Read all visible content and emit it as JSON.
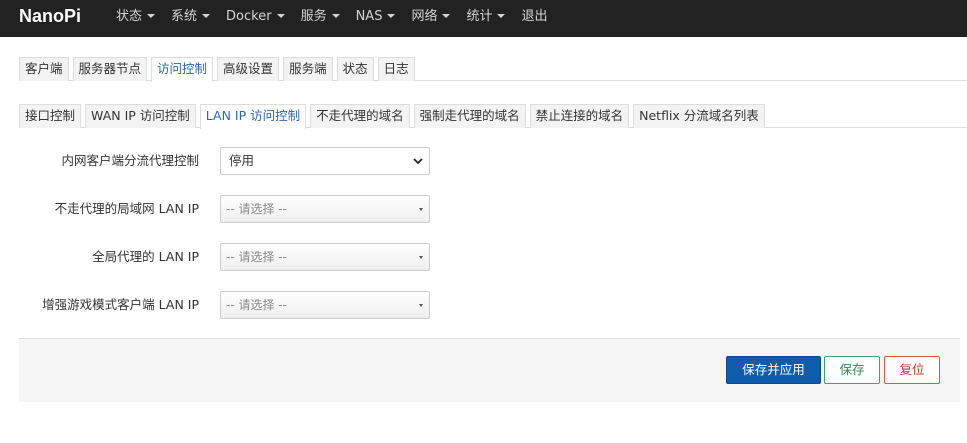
{
  "app": {
    "brand": "NanoPi"
  },
  "nav": {
    "items": [
      {
        "label": "状态",
        "caret": true
      },
      {
        "label": "系统",
        "caret": true
      },
      {
        "label": "Docker",
        "caret": true
      },
      {
        "label": "服务",
        "caret": true
      },
      {
        "label": "NAS",
        "caret": true
      },
      {
        "label": "网络",
        "caret": true
      },
      {
        "label": "统计",
        "caret": true
      },
      {
        "label": "退出",
        "caret": false
      }
    ]
  },
  "main_tabs": [
    {
      "label": "客户端"
    },
    {
      "label": "服务器节点"
    },
    {
      "label": "访问控制",
      "active": true
    },
    {
      "label": "高级设置"
    },
    {
      "label": "服务端"
    },
    {
      "label": "状态"
    },
    {
      "label": "日志"
    }
  ],
  "sub_tabs": [
    {
      "label": "接口控制"
    },
    {
      "label": "WAN IP 访问控制"
    },
    {
      "label": "LAN IP 访问控制",
      "active": true
    },
    {
      "label": "不走代理的域名"
    },
    {
      "label": "强制走代理的域名"
    },
    {
      "label": "禁止连接的域名"
    },
    {
      "label": "Netflix 分流域名列表"
    }
  ],
  "form": {
    "proxy_control": {
      "label": "内网客户端分流代理控制",
      "value": "停用"
    },
    "bypass_lan_ip": {
      "label": "不走代理的局域网 LAN IP",
      "placeholder": "-- 请选择 --"
    },
    "global_lan_ip": {
      "label": "全局代理的 LAN IP",
      "placeholder": "-- 请选择 --"
    },
    "game_lan_ip": {
      "label": "增强游戏模式客户端 LAN IP",
      "placeholder": "-- 请选择 --"
    }
  },
  "actions": {
    "save_apply": "保存并应用",
    "save": "保存",
    "reset": "复位"
  },
  "colors": {
    "navbar_bg": "#222222",
    "active_tab_text": "#2a6aaf",
    "primary_button": "#0e5cab",
    "save_button_border": "#3da56a",
    "reset_button_border": "#d9534f"
  }
}
